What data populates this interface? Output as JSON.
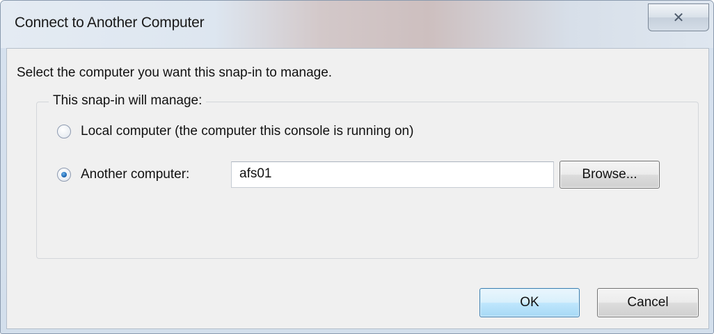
{
  "window": {
    "title": "Connect to Another Computer",
    "close_icon": "close-icon"
  },
  "dialog": {
    "instruction": "Select the computer you want this snap-in to manage.",
    "group_label": "This snap-in will manage:",
    "options": [
      {
        "label": "Local computer (the computer this console is running on)",
        "checked": false
      },
      {
        "label": "Another computer:",
        "checked": true
      }
    ],
    "computer_name_value": "afs01",
    "browse_label": "Browse..."
  },
  "footer": {
    "ok_label": "OK",
    "cancel_label": "Cancel"
  },
  "colors": {
    "title_bar": "#dfe8f3",
    "client_background": "#f0f0f0",
    "default_button_border": "#3c7fb1",
    "radio_selected": "#1f6bb8"
  }
}
